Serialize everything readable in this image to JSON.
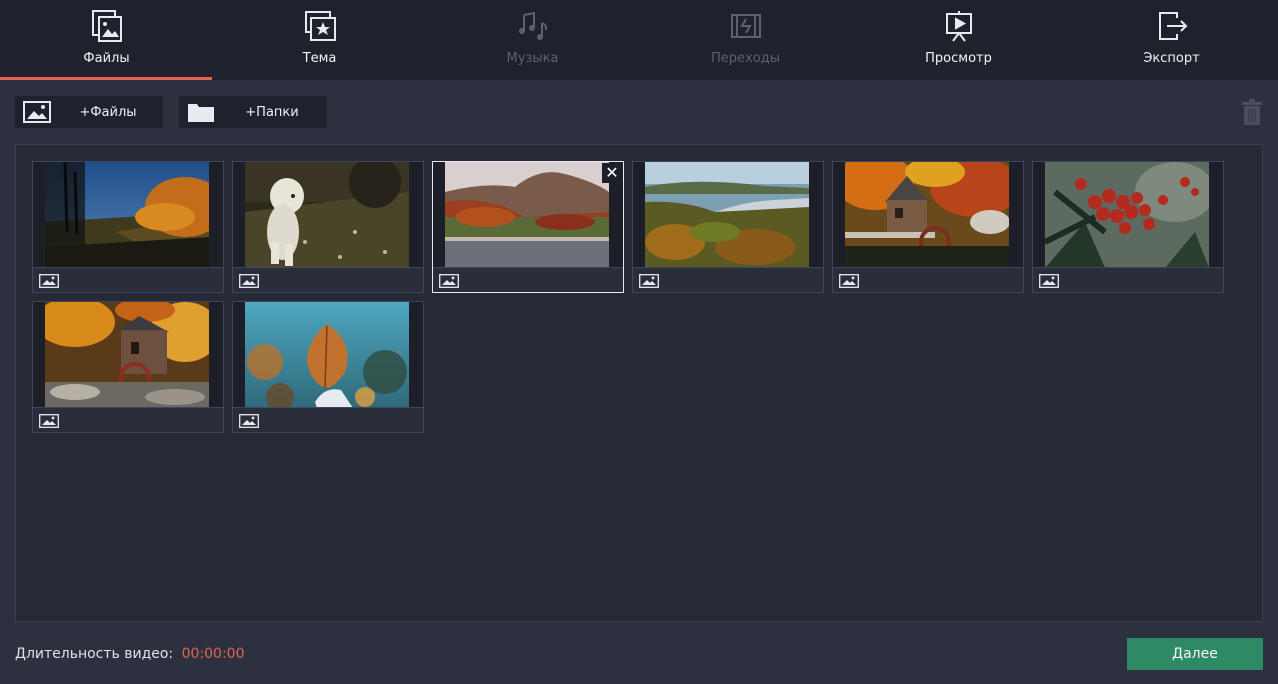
{
  "nav": {
    "tabs": [
      {
        "label": "Файлы",
        "icon": "files-icon",
        "state": "active"
      },
      {
        "label": "Тема",
        "icon": "theme-icon",
        "state": "normal"
      },
      {
        "label": "Музыка",
        "icon": "music-icon",
        "state": "disabled"
      },
      {
        "label": "Переходы",
        "icon": "transitions-icon",
        "state": "disabled"
      },
      {
        "label": "Просмотр",
        "icon": "preview-icon",
        "state": "normal"
      },
      {
        "label": "Экспорт",
        "icon": "export-icon",
        "state": "normal"
      }
    ]
  },
  "toolbar": {
    "add_files_label": "+Файлы",
    "add_folders_label": "+Папки",
    "trash_icon": "trash-icon"
  },
  "media": {
    "items": [
      {
        "scene": "forest-road",
        "type_icon": "image-icon",
        "selected": false
      },
      {
        "scene": "white-dog",
        "type_icon": "image-icon",
        "selected": false
      },
      {
        "scene": "mountain-lake",
        "type_icon": "image-icon",
        "selected": true
      },
      {
        "scene": "coastal-forest",
        "type_icon": "image-icon",
        "selected": false
      },
      {
        "scene": "mill-autumn",
        "type_icon": "image-icon",
        "selected": false
      },
      {
        "scene": "rowan-berries",
        "type_icon": "image-icon",
        "selected": false
      },
      {
        "scene": "mill-stream",
        "type_icon": "image-icon",
        "selected": false
      },
      {
        "scene": "autumn-leaf",
        "type_icon": "image-icon",
        "selected": false
      }
    ]
  },
  "footer": {
    "duration_label": "Длительность видео:",
    "duration_value": "00:00:00",
    "next_label": "Далее"
  },
  "colors": {
    "accent": "#e0654f",
    "next_button": "#2e8a65",
    "background": "#2d313f",
    "nav_background": "#1f222c"
  }
}
